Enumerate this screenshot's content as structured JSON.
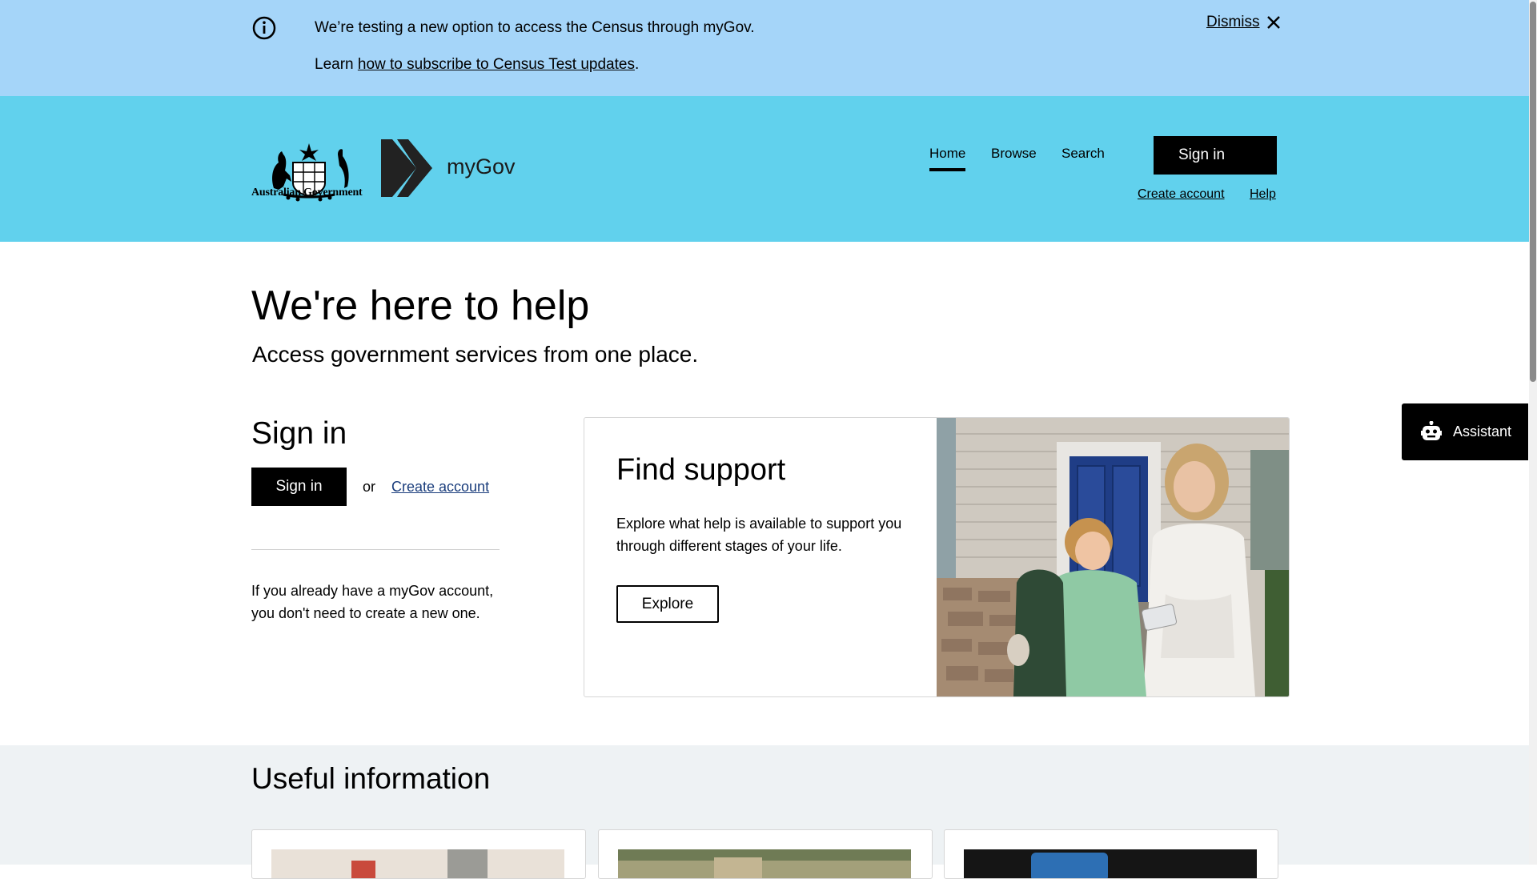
{
  "alert": {
    "line1": "We’re testing a new option to access the Census through myGov.",
    "line2_prefix": "Learn ",
    "line2_link": "how to subscribe to Census Test updates",
    "line2_suffix": ".",
    "dismiss": "Dismiss"
  },
  "header": {
    "gov_name": "Australian Government",
    "brand": "myGov",
    "nav": {
      "home": "Home",
      "browse": "Browse",
      "search": "Search"
    },
    "sign_in": "Sign in",
    "create_account": "Create account",
    "help": "Help"
  },
  "hero": {
    "title": "We're here to help",
    "subtitle": "Access government services from one place."
  },
  "signin": {
    "title": "Sign in",
    "button": "Sign in",
    "or": "or",
    "create_account": "Create account",
    "note": "If you already have a myGov account, you don't need to create a new one."
  },
  "find_support": {
    "title": "Find support",
    "text": "Explore what help is available to support you through different stages of your life.",
    "button": "Explore"
  },
  "assistant": {
    "label": "Assistant"
  },
  "useful": {
    "title": "Useful information"
  },
  "colors": {
    "alert_bg": "#a5d5f9",
    "header_bg": "#61d1ed",
    "link_blue": "#1a3d7c",
    "section_bg": "#eef2f4"
  }
}
